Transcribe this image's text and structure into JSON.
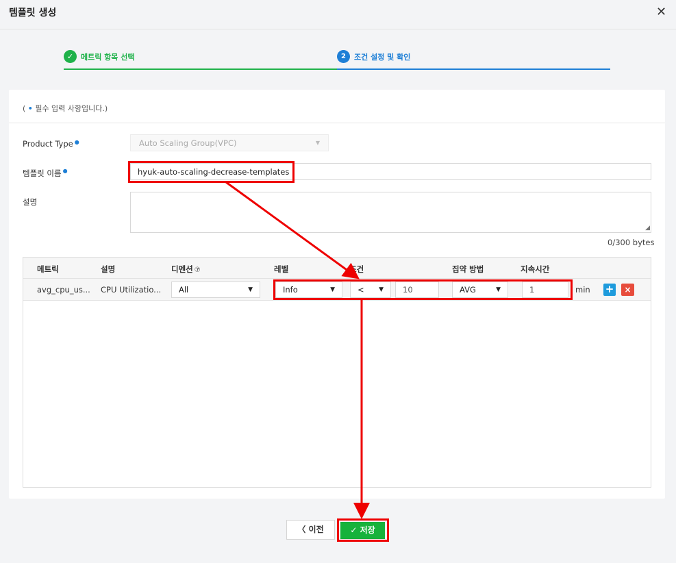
{
  "header": {
    "title": "템플릿 생성",
    "close_icon": "close-icon"
  },
  "steps": [
    {
      "number": "✓",
      "label": "메트릭 항목 선택",
      "color": "#1fb24a"
    },
    {
      "number": "2",
      "label": "조건 설정 및 확인",
      "color": "#1e7fd6"
    }
  ],
  "form": {
    "required_note_prefix": "( ",
    "required_note_dot": "•",
    "required_note_text": " 필수 입력 사항입니다.)",
    "product_type_label": "Product Type",
    "product_type_value": "Auto Scaling Group(VPC)",
    "template_name_label": "템플릿 이름",
    "template_name_value": "hyuk-auto-scaling-decrease-templates",
    "description_label": "설명",
    "description_value": "",
    "counter": "0/300 bytes",
    "required_marker": "●"
  },
  "table": {
    "headers": [
      "메트릭",
      "설명",
      "디멘션",
      "레벨",
      "조건",
      "집약 방법",
      "지속시간"
    ],
    "dimension_help_icon": "⑦",
    "row": {
      "metric": "avg_cpu_us...",
      "description": "CPU Utilizatio...",
      "dimension": "All",
      "level": "Info",
      "operator": "<",
      "threshold": "10",
      "aggregation": "AVG",
      "duration": "1",
      "unit": "min",
      "add": "+",
      "remove": "×"
    }
  },
  "buttons": {
    "prev": "이전",
    "prev_icon": "chevron-left-icon",
    "save": "저장",
    "save_icon": "check-icon"
  },
  "colors": {
    "highlight": "#ee0000",
    "save_green": "#17b23b",
    "accent_blue": "#1e7fd6"
  }
}
